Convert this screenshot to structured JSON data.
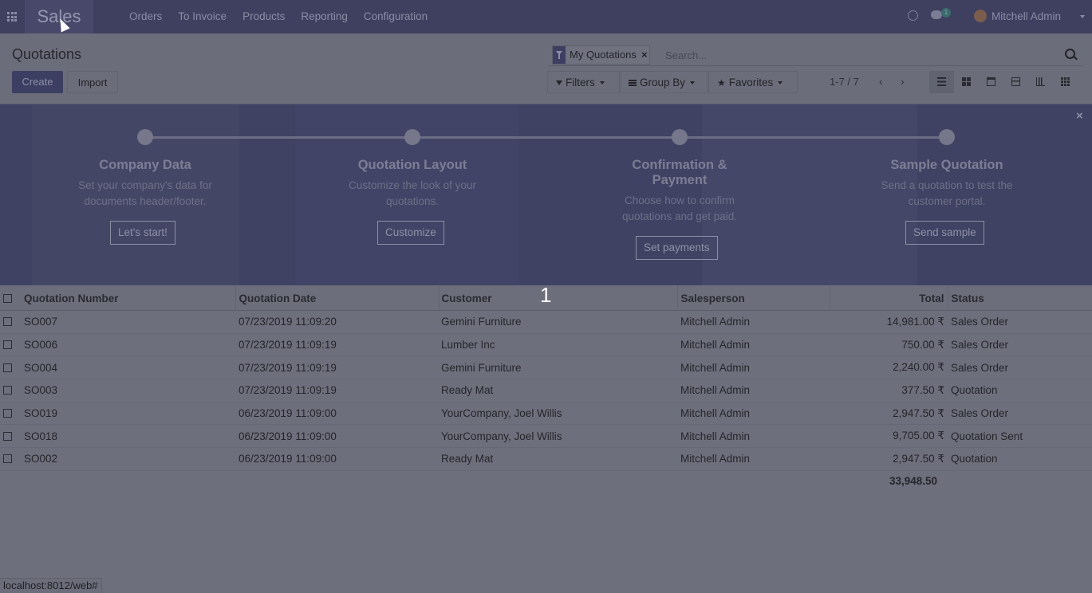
{
  "navbar": {
    "app_name": "Sales",
    "menu": [
      "Orders",
      "To Invoice",
      "Products",
      "Reporting",
      "Configuration"
    ],
    "chat_count": "1",
    "user_name": "Mitchell Admin"
  },
  "control_panel": {
    "breadcrumb": "Quotations",
    "create_label": "Create",
    "import_label": "Import",
    "facet_label": "My Quotations",
    "search_placeholder": "Search...",
    "filters_label": "Filters",
    "groupby_label": "Group By",
    "favorites_label": "Favorites",
    "pager": "1-7 / 7",
    "views": [
      "list-view",
      "kanban-view",
      "calendar-view",
      "pivot-view",
      "graph-view",
      "grid-view"
    ],
    "active_view": "list-view"
  },
  "onboarding": {
    "steps": [
      {
        "title": "Company Data",
        "desc": [
          "Set your company's data for",
          "documents header/footer."
        ],
        "button": "Let's start!"
      },
      {
        "title": "Quotation Layout",
        "desc": [
          "Customize the look of your",
          "quotations."
        ],
        "button": "Customize"
      },
      {
        "title": "Confirmation &",
        "title2": "Payment",
        "desc": [
          "Choose how to confirm",
          "quotations and get paid."
        ],
        "button": "Set payments"
      },
      {
        "title": "Sample Quotation",
        "desc": [
          "Send a quotation to test the",
          "customer portal."
        ],
        "button": "Send sample"
      }
    ]
  },
  "table": {
    "headers": [
      "Quotation Number",
      "Quotation Date",
      "Customer",
      "Salesperson",
      "Total",
      "Status"
    ],
    "rows": [
      [
        "SO007",
        "07/23/2019 11:09:20",
        "Gemini Furniture",
        "Mitchell Admin",
        "14,981.00 ₹",
        "Sales Order"
      ],
      [
        "SO006",
        "07/23/2019 11:09:19",
        "Lumber Inc",
        "Mitchell Admin",
        "750.00 ₹",
        "Sales Order"
      ],
      [
        "SO004",
        "07/23/2019 11:09:19",
        "Gemini Furniture",
        "Mitchell Admin",
        "2,240.00 ₹",
        "Sales Order"
      ],
      [
        "SO003",
        "07/23/2019 11:09:19",
        "Ready Mat",
        "Mitchell Admin",
        "377.50 ₹",
        "Quotation"
      ],
      [
        "SO019",
        "06/23/2019 11:09:00",
        "YourCompany, Joel Willis",
        "Mitchell Admin",
        "2,947.50 ₹",
        "Sales Order"
      ],
      [
        "SO018",
        "06/23/2019 11:09:00",
        "YourCompany, Joel Willis",
        "Mitchell Admin",
        "9,705.00 ₹",
        "Quotation Sent"
      ],
      [
        "SO002",
        "06/23/2019 11:09:00",
        "Ready Mat",
        "Mitchell Admin",
        "2,947.50 ₹",
        "Quotation"
      ]
    ],
    "sum_total": "33,948.50"
  },
  "annotation_marker": "1",
  "statusbar_url": "localhost:8012/web#"
}
